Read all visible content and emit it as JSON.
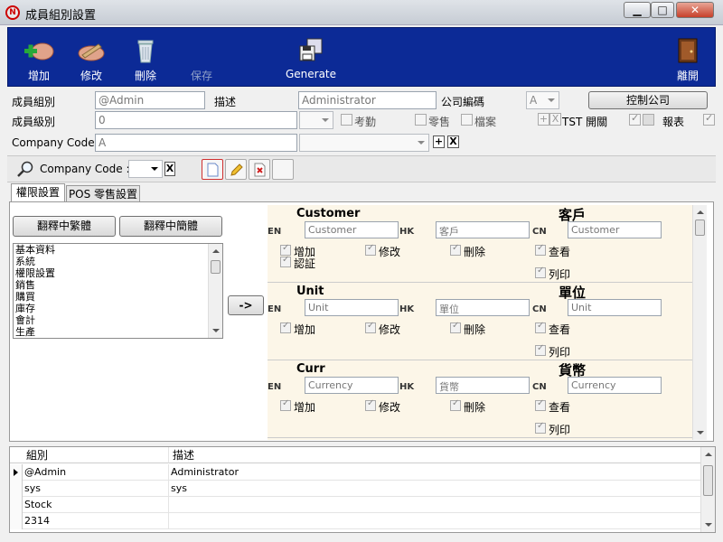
{
  "window": {
    "title": "成員組別設置",
    "app_icon_text": "N",
    "min_symbol": "▁",
    "max_symbol": "□",
    "close_symbol": "✕"
  },
  "toolbar": {
    "add_label": "增加",
    "edit_label": "修改",
    "delete_label": "刪除",
    "save_label": "保存",
    "generate_label": "Generate",
    "exit_label": "離開"
  },
  "form": {
    "group_label": "成員組別",
    "group_value": "@Admin",
    "desc_label": "描述",
    "desc_value": "Administrator",
    "company_no_label": "公司編碼",
    "company_no_value": "A",
    "control_company_button": "控制公司",
    "level_label": "成員級別",
    "level_value": "0",
    "attendance_label": "考勤",
    "retail_label": "零售",
    "file_label": "檔案",
    "tst_label": "TST 開關",
    "report_label": "報表",
    "company_code_label": "Company Code :",
    "company_code_value": "A",
    "plus_symbol": "+",
    "x_symbol": "X"
  },
  "toolbar2": {
    "company_code_label": "Company Code :",
    "x_symbol": "X"
  },
  "tabs": [
    {
      "label": "權限設置",
      "active": true
    },
    {
      "label": "POS 零售設置",
      "active": false
    }
  ],
  "translate_buttons": {
    "to_trad": "翻釋中繁體",
    "to_simp": "翻釋中簡體"
  },
  "modules": [
    "基本資料",
    "系統",
    "權限設置",
    "銷售",
    "購買",
    "庫存",
    "會計",
    "生產"
  ],
  "arrow_button": "->",
  "permission_sections": [
    {
      "title_en": "Customer",
      "title_cn": "客戶",
      "en_tag": "EN",
      "hk_tag": "HK",
      "cn_tag": "CN",
      "en_value": "Customer",
      "hk_value": "客戶",
      "cn_value": "Customer",
      "checks": [
        "增加",
        "修改",
        "刪除",
        "查看",
        "認証",
        "列印"
      ]
    },
    {
      "title_en": "Unit",
      "title_cn": "單位",
      "en_tag": "EN",
      "hk_tag": "HK",
      "cn_tag": "CN",
      "en_value": "Unit",
      "hk_value": "單位",
      "cn_value": "Unit",
      "checks": [
        "增加",
        "修改",
        "刪除",
        "查看",
        "列印"
      ]
    },
    {
      "title_en": "Curr",
      "title_cn": "貨幣",
      "en_tag": "EN",
      "hk_tag": "HK",
      "cn_tag": "CN",
      "en_value": "Currency",
      "hk_value": "貨幣",
      "cn_value": "Currency",
      "checks": [
        "增加",
        "修改",
        "刪除",
        "查看",
        "列印"
      ]
    }
  ],
  "grid": {
    "columns": [
      "組別",
      "描述"
    ],
    "rows": [
      {
        "group": "@Admin",
        "desc": "Administrator",
        "current": true
      },
      {
        "group": "sys",
        "desc": "sys",
        "current": false
      },
      {
        "group": "Stock",
        "desc": "",
        "current": false
      },
      {
        "group": "2314",
        "desc": "",
        "current": false
      }
    ]
  },
  "colors": {
    "toolbar_bg": "#0c2a96",
    "permission_bg": "#fcf6e8",
    "close_red": "#c7402a"
  }
}
